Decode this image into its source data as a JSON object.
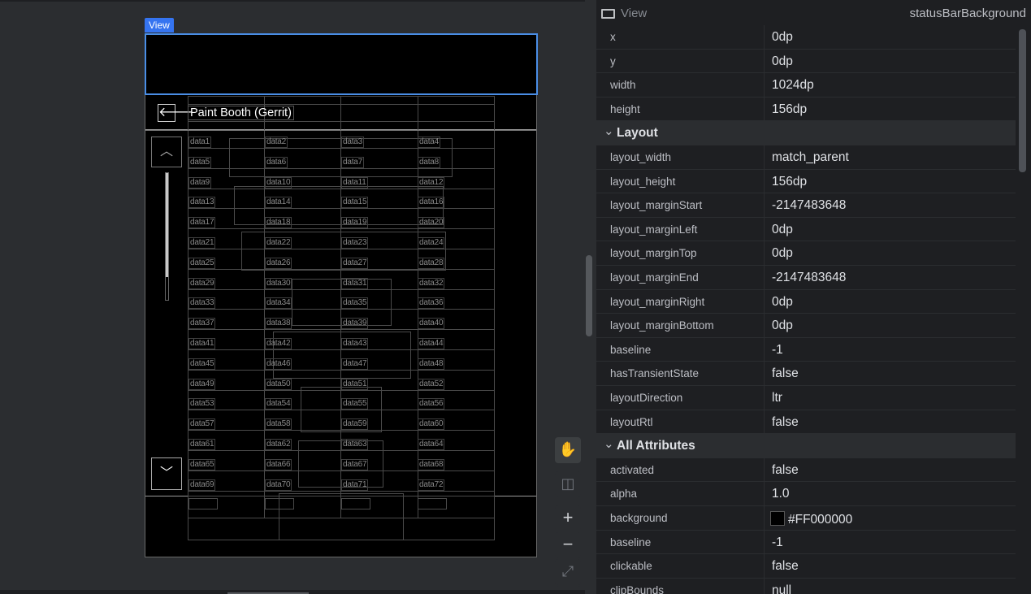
{
  "selection_tag": "View",
  "device": {
    "title": "Paint Booth (Gerrit)",
    "back_glyph": "🡐",
    "up_glyph": "︿",
    "down_glyph": "﹀",
    "cells": [
      "data1",
      "data2",
      "data3",
      "data4",
      "data5",
      "data6",
      "data7",
      "data8",
      "data9",
      "data10",
      "data11",
      "data12",
      "data13",
      "data14",
      "data15",
      "data16",
      "data17",
      "data18",
      "data19",
      "data20",
      "data21",
      "data22",
      "data23",
      "data24",
      "data25",
      "data26",
      "data27",
      "data28",
      "data29",
      "data30",
      "data31",
      "data32",
      "data33",
      "data34",
      "data35",
      "data36",
      "data37",
      "data38",
      "data39",
      "data40",
      "data41",
      "data42",
      "data43",
      "data44",
      "data45",
      "data46",
      "data47",
      "data48",
      "data49",
      "data50",
      "data51",
      "data52",
      "data53",
      "data54",
      "data55",
      "data56",
      "data57",
      "data58",
      "data59",
      "data60",
      "data61",
      "data62",
      "data63",
      "data64",
      "data65",
      "data66",
      "data67",
      "data68",
      "data69",
      "data70",
      "data71",
      "data72"
    ]
  },
  "tools": {
    "pan_icon": "✋",
    "frame_icon": "◫",
    "zoom_in": "+",
    "zoom_out": "−",
    "fit_icon": "⤢"
  },
  "panel": {
    "header_title": "View",
    "header_id": "statusBarBackground",
    "basic": [
      {
        "key": "x",
        "value": "0dp"
      },
      {
        "key": "y",
        "value": "0dp"
      },
      {
        "key": "width",
        "value": "1024dp"
      },
      {
        "key": "height",
        "value": "156dp"
      }
    ],
    "layout_title": "Layout",
    "layout": [
      {
        "key": "layout_width",
        "value": "match_parent"
      },
      {
        "key": "layout_height",
        "value": "156dp"
      },
      {
        "key": "layout_marginStart",
        "value": "-2147483648"
      },
      {
        "key": "layout_marginLeft",
        "value": "0dp"
      },
      {
        "key": "layout_marginTop",
        "value": "0dp"
      },
      {
        "key": "layout_marginEnd",
        "value": "-2147483648"
      },
      {
        "key": "layout_marginRight",
        "value": "0dp"
      },
      {
        "key": "layout_marginBottom",
        "value": "0dp"
      },
      {
        "key": "baseline",
        "value": "-1"
      },
      {
        "key": "hasTransientState",
        "value": "false"
      },
      {
        "key": "layoutDirection",
        "value": "ltr"
      },
      {
        "key": "layoutRtl",
        "value": "false"
      }
    ],
    "all_title": "All Attributes",
    "all": [
      {
        "key": "activated",
        "value": "false"
      },
      {
        "key": "alpha",
        "value": "1.0"
      },
      {
        "key": "background",
        "value": "#FF000000"
      },
      {
        "key": "baseline",
        "value": "-1"
      },
      {
        "key": "clickable",
        "value": "false"
      },
      {
        "key": "clipBounds",
        "value": "null"
      }
    ],
    "chevron": "⌄"
  }
}
